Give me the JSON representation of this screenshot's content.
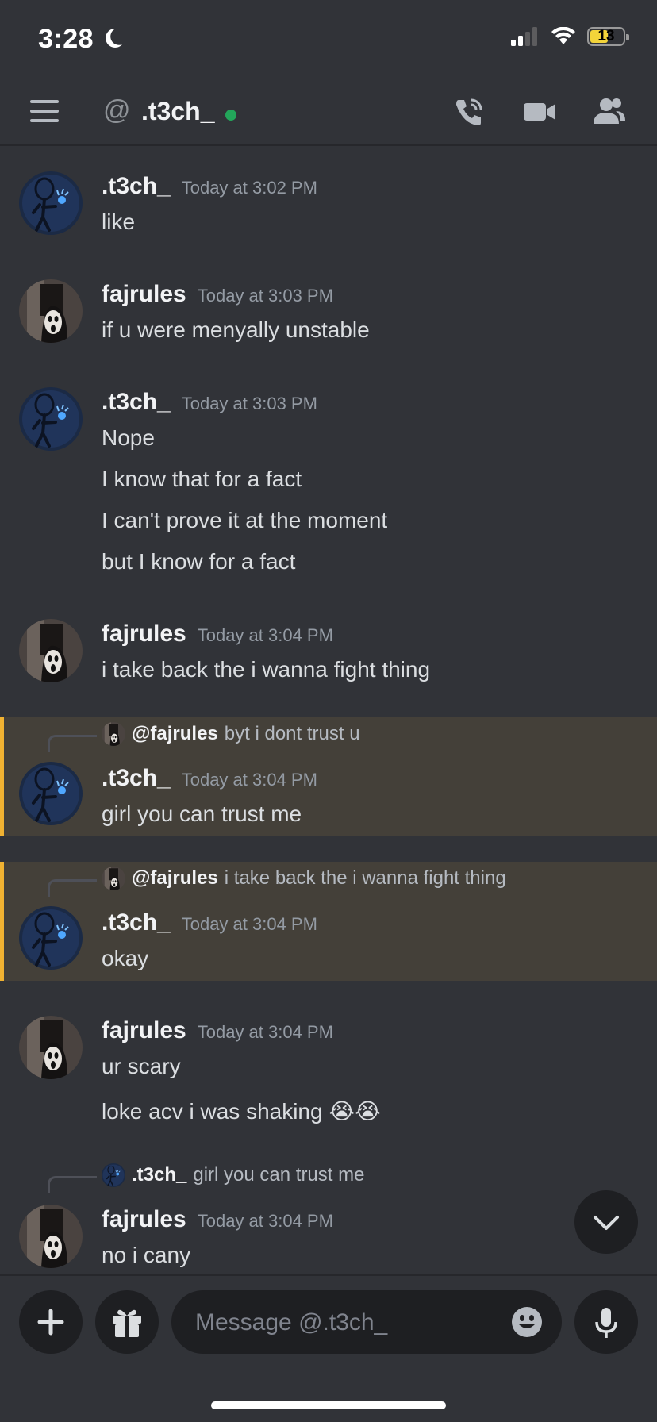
{
  "status_bar": {
    "time": "3:28",
    "battery": "13"
  },
  "header": {
    "at_symbol": "@",
    "name": ".t3ch_"
  },
  "messages": [
    {
      "user": ".t3ch_",
      "time": "Today at 3:02 PM",
      "lines": [
        "like"
      ]
    },
    {
      "user": "fajrules",
      "time": "Today at 3:03 PM",
      "lines": [
        "if u were menyally unstable"
      ]
    },
    {
      "user": ".t3ch_",
      "time": "Today at 3:03 PM",
      "lines": [
        "Nope",
        "I know that for a fact",
        "I can't prove it at the moment",
        "but I know for a fact"
      ]
    },
    {
      "user": "fajrules",
      "time": "Today at 3:04 PM",
      "lines": [
        "i take back the i wanna fight thing"
      ]
    },
    {
      "user": ".t3ch_",
      "time": "Today at 3:04 PM",
      "reply_to": {
        "user": "@fajrules",
        "text": "byt i dont trust u"
      },
      "lines": [
        "girl you can trust me"
      ]
    },
    {
      "user": ".t3ch_",
      "time": "Today at 3:04 PM",
      "reply_to": {
        "user": "@fajrules",
        "text": "i take back the i wanna fight thing"
      },
      "lines": [
        "okay"
      ]
    },
    {
      "user": "fajrules",
      "time": "Today at 3:04 PM",
      "lines": [
        "ur  scary",
        "loke acv i was shaking 😭😭"
      ]
    },
    {
      "user": "fajrules",
      "time": "Today at 3:04 PM",
      "reply_to": {
        "user": ".t3ch_",
        "text": "girl you can trust me"
      },
      "lines": [
        "no i cany"
      ]
    }
  ],
  "composer": {
    "placeholder": "Message @.t3ch_"
  },
  "colors": {
    "background": "#313338",
    "online": "#23a55a",
    "mention_highlight": "#444039",
    "mention_bar": "#f0b232"
  }
}
